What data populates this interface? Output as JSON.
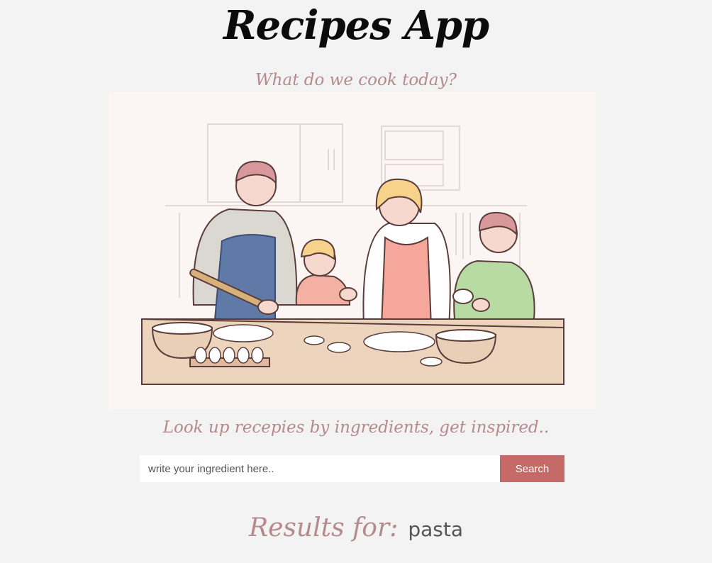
{
  "app": {
    "title": "Recipes App",
    "tagline": "What do we cook today?"
  },
  "hero": {
    "image_name": "family-cooking-illustration"
  },
  "search": {
    "heading": "Look up recepies by ingredients, get inspired..",
    "placeholder": "write your ingredient here..",
    "button_label": "Search"
  },
  "results": {
    "label": "Results for:",
    "term": "pasta"
  },
  "colors": {
    "accent": "#c56a67",
    "heading_pink": "#b48a8c",
    "background": "#f3f3f3"
  }
}
